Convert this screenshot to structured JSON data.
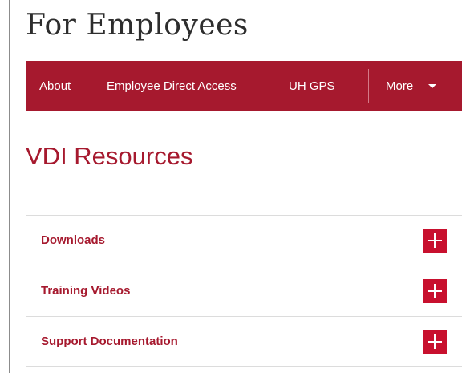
{
  "site": {
    "title": "For Employees"
  },
  "nav": {
    "items": [
      {
        "label": "About"
      },
      {
        "label": "Employee Direct Access"
      },
      {
        "label": "UH GPS"
      },
      {
        "label": "More"
      }
    ],
    "background_color": "#a6192e"
  },
  "page": {
    "heading": "VDI Resources"
  },
  "accordion": {
    "items": [
      {
        "label": "Downloads",
        "expanded": false,
        "icon": "plus-icon"
      },
      {
        "label": "Training Videos",
        "expanded": false,
        "icon": "plus-icon"
      },
      {
        "label": "Support Documentation",
        "expanded": false,
        "icon": "plus-icon"
      }
    ],
    "toggle_color": "#c8102e",
    "label_color": "#a6192e"
  }
}
